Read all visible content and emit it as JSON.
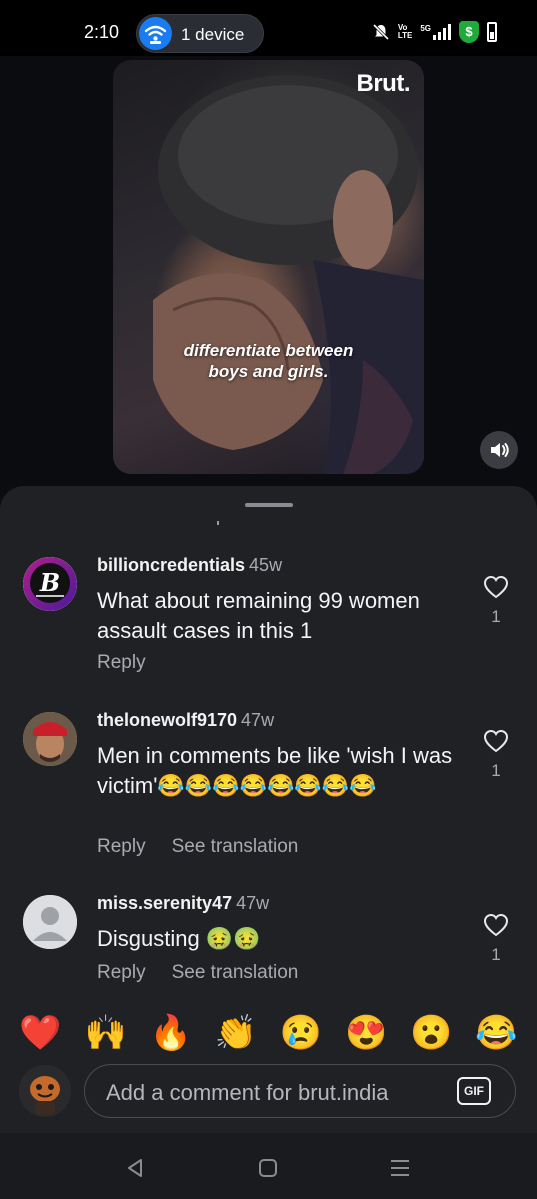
{
  "status_bar": {
    "time": "2:10",
    "device_pill_label": "1 device",
    "network": "5G"
  },
  "video": {
    "brand": "Brut.",
    "caption_line1": "differentiate between",
    "caption_line2": "boys and girls."
  },
  "comments": [
    {
      "username": "billioncredentials",
      "age": "45w",
      "text": "What about remaining 99 women assault cases in this 1",
      "reply_label": "Reply",
      "likes": "1"
    },
    {
      "username": "thelonewolf9170",
      "age": "47w",
      "text": "Men in comments be like 'wish I was victim'😂😂😂😂😂😂😂😂",
      "reply_label": "Reply",
      "translate_label": "See translation",
      "likes": "1"
    },
    {
      "username": "miss.serenity47",
      "age": "47w",
      "text": "Disgusting 🤢🤢",
      "reply_label": "Reply",
      "translate_label": "See translation",
      "likes": "1"
    }
  ],
  "reactions": [
    "❤️",
    "🙌",
    "🔥",
    "👏",
    "😢",
    "😍",
    "😮",
    "😂"
  ],
  "composer": {
    "placeholder": "Add a comment for brut.india",
    "gif_label": "GIF"
  },
  "colors": {
    "sheet_bg": "#1f2125",
    "accent_blue": "#1b7bf0",
    "secondary_text": "#a8aab0"
  }
}
